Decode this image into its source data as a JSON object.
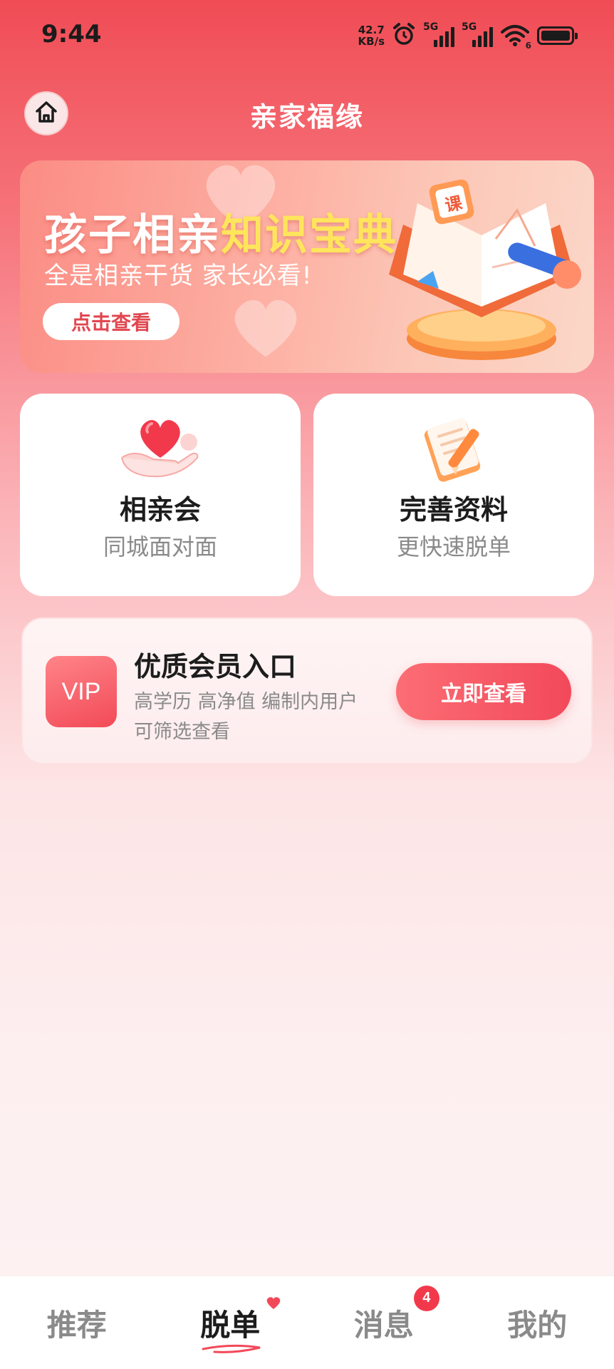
{
  "status_bar": {
    "time": "9:44",
    "net_speed_value": "42.7",
    "net_speed_unit": "KB/s",
    "sim1_label": "5G",
    "sim2_label": "5G",
    "wifi_label": "6",
    "icons": [
      "alarm-icon",
      "signal-icon",
      "wifi-icon",
      "battery-icon"
    ]
  },
  "header": {
    "title": "亲家福缘",
    "home_icon": "home-icon"
  },
  "banner": {
    "title_main": "孩子相亲",
    "title_highlight": "知识宝典",
    "subtitle": "全是相亲干货 家长必看!",
    "button_label": "点击查看",
    "art_badge": "课"
  },
  "cards": [
    {
      "title": "相亲会",
      "subtitle": "同城面对面",
      "icon": "heart-hand-icon"
    },
    {
      "title": "完善资料",
      "subtitle": "更快速脱单",
      "icon": "notepad-pen-icon"
    }
  ],
  "vip": {
    "badge": "VIP",
    "title": "优质会员入口",
    "description": "高学历 高净值 编制内用户可筛选查看",
    "button_label": "立即查看"
  },
  "bottom_nav": {
    "items": [
      {
        "label": "推荐"
      },
      {
        "label": "脱单"
      },
      {
        "label": "消息",
        "badge": "4"
      },
      {
        "label": "我的"
      }
    ],
    "active_index": 1
  },
  "colors": {
    "accent": "#f2495a",
    "highlight": "#ffe55c",
    "header_top": "#f04c55"
  }
}
